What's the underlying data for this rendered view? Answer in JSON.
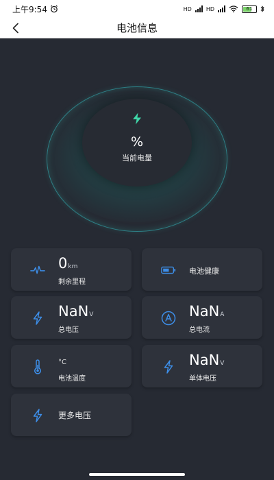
{
  "status_bar": {
    "time": "上午9:54",
    "network_1": "HD",
    "network_2": "HD",
    "battery_level": "61"
  },
  "nav": {
    "title": "电池信息"
  },
  "battery": {
    "percent_text": "%",
    "label": "当前电量"
  },
  "cards": {
    "mileage": {
      "value": "0",
      "unit": "km",
      "label": "剩余里程"
    },
    "health": {
      "label": "电池健康"
    },
    "total_voltage": {
      "value": "NaN",
      "unit": "V",
      "label": "总电压"
    },
    "total_current": {
      "value": "NaN",
      "unit": "A",
      "label": "总电流"
    },
    "temperature": {
      "value": "°C",
      "label": "电池温度"
    },
    "cell_voltage": {
      "value": "NaN",
      "unit": "V",
      "label": "单体电压"
    },
    "more_voltage": {
      "label": "更多电压"
    }
  },
  "colors": {
    "background": "#262a33",
    "card": "#2e323b",
    "accent_blue": "#3d8ee8",
    "accent_green": "#3fd6a8",
    "ring": "#2e7f86"
  },
  "icons": {
    "back": "chevron-left-icon",
    "charge": "lightning-icon",
    "mileage": "heartbeat-icon",
    "health": "battery-icon",
    "voltage": "lightning-icon",
    "current": "ampere-icon",
    "temperature": "thermometer-icon"
  }
}
